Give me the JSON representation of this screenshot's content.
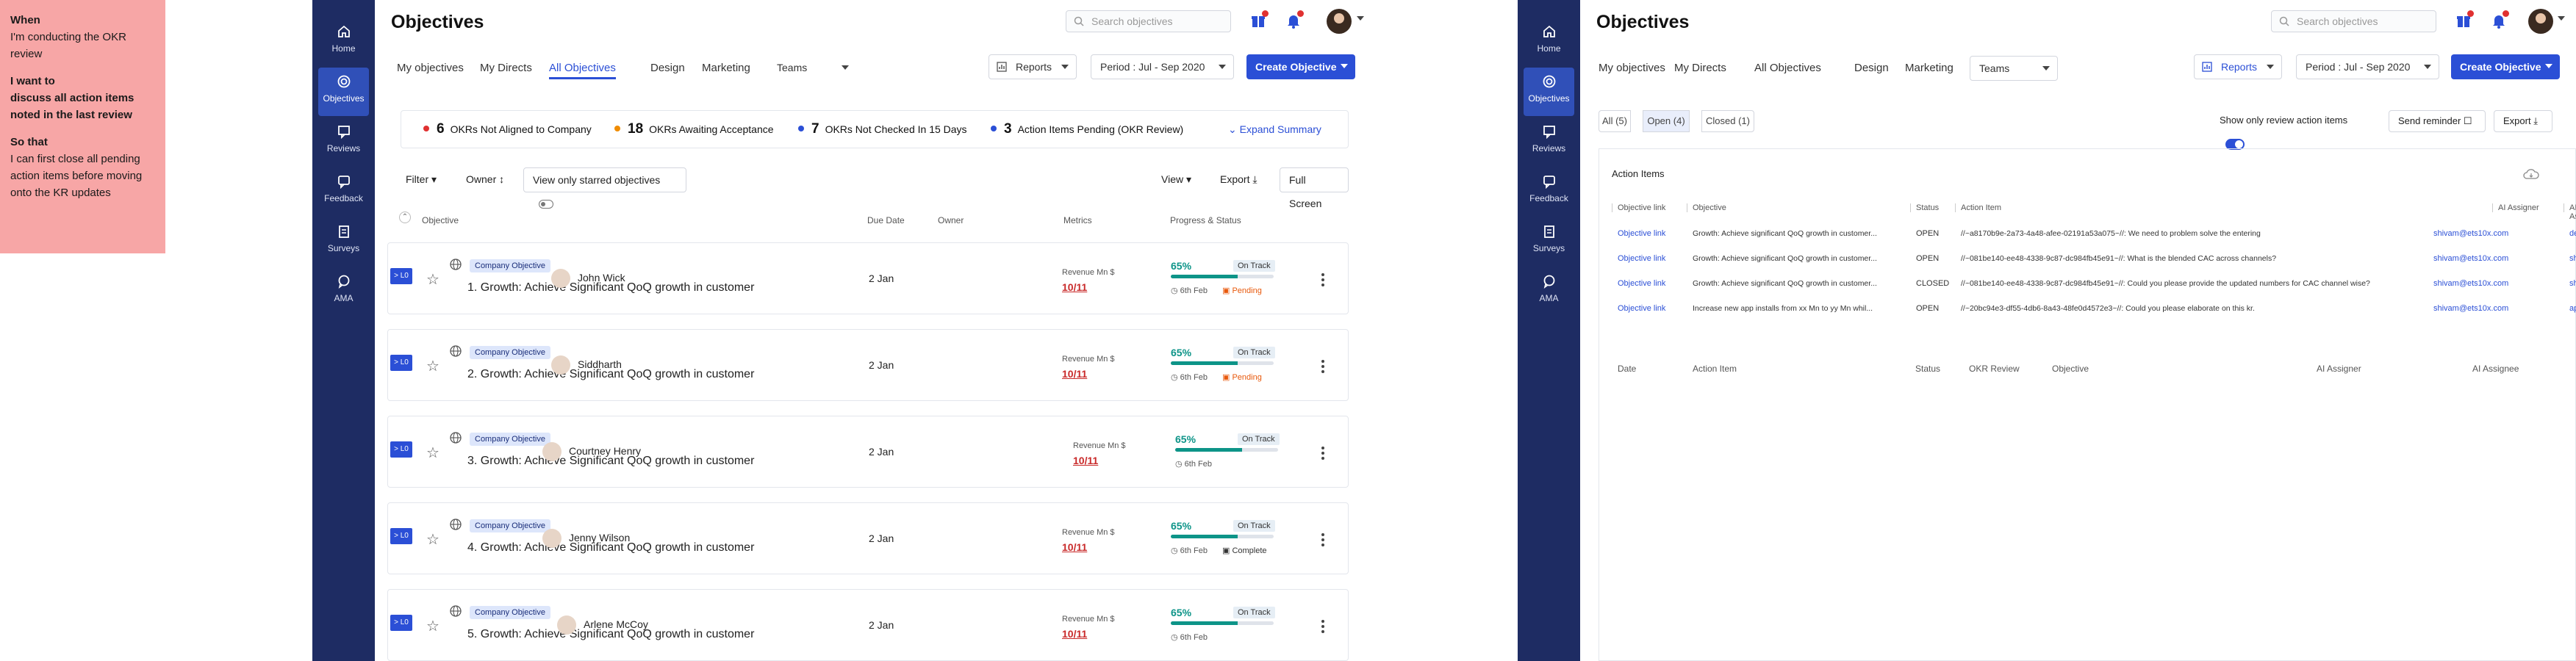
{
  "story": {
    "when_label": "When",
    "when_text": "I'm conducting the OKR review",
    "want_label": "I want to",
    "want_text": "discuss all action items noted in the last review",
    "so_label": "So that",
    "so_text": "I can first close all pending action items before moving onto the KR updates"
  },
  "nav": [
    {
      "label": "Home",
      "icon": "home-icon"
    },
    {
      "label": "Objectives",
      "icon": "target-icon"
    },
    {
      "label": "Reviews",
      "icon": "reviews-icon"
    },
    {
      "label": "Feedback",
      "icon": "feedback-icon"
    },
    {
      "label": "Surveys",
      "icon": "surveys-icon"
    },
    {
      "label": "AMA",
      "icon": "chat-icon"
    }
  ],
  "colors": {
    "sidebar": "#1e2c63",
    "accent": "#2b4fd6",
    "teal": "#0d9488",
    "red": "#c92a2a",
    "orange": "#e8590c",
    "story": "#f7a6a6"
  },
  "header": {
    "title": "Objectives",
    "search_placeholder": "Search objectives",
    "tabs": [
      "My objectives",
      "My Directs",
      "All Objectives",
      "Design",
      "Marketing"
    ],
    "teams": "Teams",
    "reports": "Reports",
    "period": "Period : Jul - Sep 2020",
    "create": "Create Objective"
  },
  "summary": {
    "items": [
      {
        "count": "6",
        "label": "OKRs Not Aligned to Company",
        "color": "#e03131"
      },
      {
        "count": "18",
        "label": "OKRs Awaiting Acceptance",
        "color": "#f08c00"
      },
      {
        "count": "7",
        "label": "OKRs Not Checked In 15 Days",
        "color": "#2b4fd6"
      },
      {
        "count": "3",
        "label": "Action Items Pending (OKR Review)",
        "color": "#2b4fd6"
      }
    ],
    "expand": "Expand Summary"
  },
  "toolbar": {
    "filter": "Filter",
    "owner": "Owner",
    "starred": "View only starred objectives",
    "view": "View",
    "export": "Export",
    "fullscreen": "Full Screen"
  },
  "columns": {
    "objective": "Objective",
    "due": "Due Date",
    "owner": "Owner",
    "metrics": "Metrics",
    "progress": "Progress & Status"
  },
  "objectives": [
    {
      "level": "> L0",
      "badge": "Company Objective",
      "title": "1. Growth: Achieve Significant QoQ growth in customer",
      "due": "2 Jan",
      "owner": "John Wick",
      "metric_label": "Revenue Mn $",
      "metric_value": "10/11",
      "pct": "65%",
      "progress": 0.65,
      "status": "On Track",
      "date": "6th Feb",
      "state": "Pending"
    },
    {
      "level": "> L0",
      "badge": "Company Objective",
      "title": "2. Growth: Achieve Significant QoQ growth in customer",
      "due": "2 Jan",
      "owner": "Siddharth",
      "metric_label": "Revenue Mn $",
      "metric_value": "10/11",
      "pct": "65%",
      "progress": 0.65,
      "status": "On Track",
      "date": "6th Feb",
      "state": "Pending"
    },
    {
      "level": "> L0",
      "badge": "Company Objective",
      "title": "3. Growth: Achieve Significant QoQ growth in customer",
      "due": "2 Jan",
      "owner": "Courtney Henry",
      "metric_label": "Revenue Mn $",
      "metric_value": "10/11",
      "pct": "65%",
      "progress": 0.65,
      "status": "On Track",
      "date": "6th Feb",
      "state": ""
    },
    {
      "level": "> L0",
      "badge": "Company Objective",
      "title": "4. Growth: Achieve Significant QoQ growth in customer",
      "due": "2 Jan",
      "owner": "Jenny Wilson",
      "metric_label": "Revenue Mn $",
      "metric_value": "10/11",
      "pct": "65%",
      "progress": 0.65,
      "status": "On Track",
      "date": "6th Feb",
      "state": "Complete"
    },
    {
      "level": "> L0",
      "badge": "Company Objective",
      "title": "5. Growth: Achieve Significant QoQ growth in customer",
      "due": "2 Jan",
      "owner": "Arlene McCoy",
      "metric_label": "Revenue Mn $",
      "metric_value": "10/11",
      "pct": "65%",
      "progress": 0.65,
      "status": "On Track",
      "date": "6th Feb",
      "state": ""
    }
  ],
  "right": {
    "filters": [
      "All (5)",
      "Open (4)",
      "Closed (1)"
    ],
    "review_toggle": "Show only review action items",
    "send_reminder": "Send reminder",
    "export": "Export",
    "section_title": "Action Items",
    "ai_headers": [
      "Objective link",
      "Objective",
      "Status",
      "Action Item",
      "AI Assigner",
      "AI As"
    ],
    "ai_rows": [
      {
        "link": "Objective link",
        "objective": "Growth: Achieve significant QoQ growth in customer...",
        "status": "OPEN",
        "item": "//~a8170b9e-2a73-4a48-afee-02191a53a075~//: We need to problem solve the entering",
        "assigner": "shivam@ets10x.com",
        "assignee": "deepak"
      },
      {
        "link": "Objective link",
        "objective": "Growth: Achieve significant QoQ growth in customer...",
        "status": "OPEN",
        "item": "//~081be140-ee48-4338-9c87-dc984fb45e91~//: What is the blended CAC across channels?",
        "assigner": "shivam@ets10x.com",
        "assignee": "shanta"
      },
      {
        "link": "Objective link",
        "objective": "Growth: Achieve significant QoQ growth in customer...",
        "status": "CLOSED",
        "item": "//~081be140-ee48-4338-9c87-dc984fb45e91~//: Could you please provide the updated numbers for CAC channel wise?",
        "assigner": "shivam@ets10x.com",
        "assignee": "shanta"
      },
      {
        "link": "Objective link",
        "objective": "Increase new app installs from xx Mn to yy Mn whil...",
        "status": "OPEN",
        "item": "//~20bc94e3-df55-4db6-8a43-48fe0d4572e3~//: Could you please elaborate on this kr.",
        "assigner": "shivam@ets10x.com",
        "assignee": "apurva"
      }
    ],
    "bottom_headers": [
      "Date",
      "Action Item",
      "Status",
      "OKR Review",
      "Objective",
      "AI Assigner",
      "AI Assignee"
    ]
  }
}
